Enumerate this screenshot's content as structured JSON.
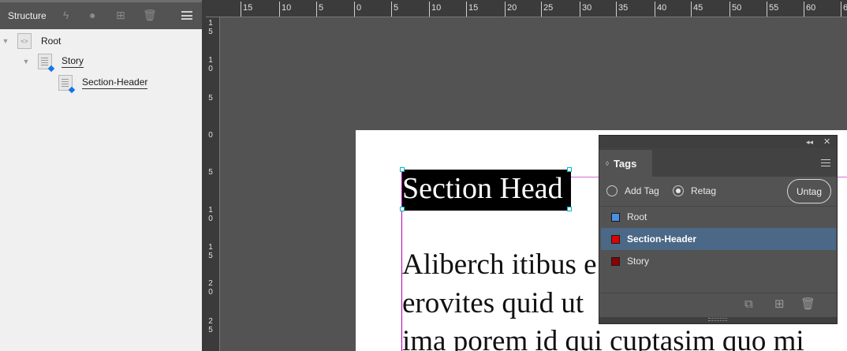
{
  "structure_panel": {
    "title": "Structure",
    "tree": [
      {
        "label": "Root"
      },
      {
        "label": "Story"
      },
      {
        "label": "Section-Header"
      }
    ]
  },
  "ruler": {
    "top_labels": [
      "15",
      "10",
      "5",
      "0",
      "5",
      "10",
      "15",
      "20",
      "25",
      "30",
      "35",
      "40",
      "45",
      "50",
      "55",
      "60",
      "6"
    ],
    "left_labels": [
      [
        "1",
        "5"
      ],
      [
        "1",
        "0"
      ],
      [
        "5"
      ],
      [
        "0"
      ],
      [
        "5"
      ],
      [
        "1",
        "0"
      ],
      [
        "1",
        "5"
      ],
      [
        "2",
        "0"
      ],
      [
        "2",
        "5"
      ]
    ]
  },
  "document": {
    "heading": "Section Head",
    "body_lines": [
      "Aliberch itibus e",
      "erovites quid ut",
      "ima porem id qui cuptasim quo mi"
    ]
  },
  "tags_panel": {
    "title": "Tags",
    "add_tag_label": "Add Tag",
    "retag_label": "Retag",
    "mode": "Retag",
    "untag_label": "Untag",
    "tags": [
      {
        "name": "Root",
        "color": "#4a90e2",
        "selected": false
      },
      {
        "name": "Section-Header",
        "color": "#e00000",
        "selected": true
      },
      {
        "name": "Story",
        "color": "#8b0000",
        "selected": false
      }
    ]
  },
  "colors": {
    "selection": "#4b6887",
    "margin_guide": "#b400b4",
    "frame_handle": "#00b7c2"
  }
}
